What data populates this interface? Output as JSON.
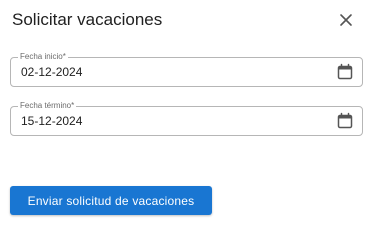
{
  "dialog": {
    "title": "Solicitar vacaciones",
    "close_icon": "close-icon"
  },
  "fields": {
    "start_date": {
      "label": "Fecha inicio*",
      "value": "02-12-2024",
      "icon": "calendar-icon"
    },
    "end_date": {
      "label": "Fecha término*",
      "value": "15-12-2024",
      "icon": "calendar-icon"
    }
  },
  "actions": {
    "submit_label": "Enviar solicitud de vacaciones"
  },
  "colors": {
    "primary": "#1976d2",
    "text": "#212121",
    "border": "#b6b6b6",
    "label": "#6b6b6b"
  }
}
